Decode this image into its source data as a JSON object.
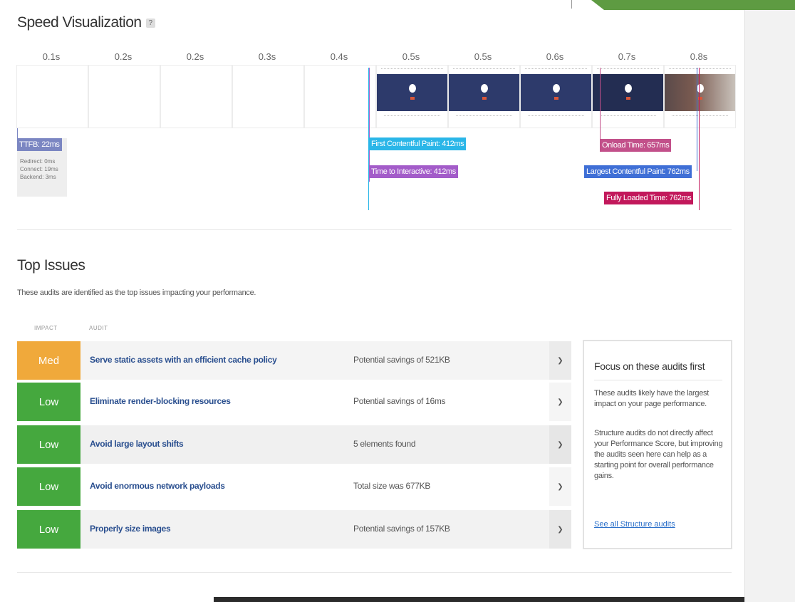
{
  "speed_visualization": {
    "title": "Speed Visualization",
    "help_icon": "help-icon",
    "ticks": [
      "0.1s",
      "0.2s",
      "0.2s",
      "0.3s",
      "0.4s",
      "0.5s",
      "0.5s",
      "0.6s",
      "0.7s",
      "0.8s"
    ],
    "ttfb": {
      "label": "TTFB: 22ms",
      "details": [
        "Redirect: 0ms",
        "Connect: 19ms",
        "Backend: 3ms"
      ]
    },
    "markers": {
      "fcp": "First Contentful Paint: 412ms",
      "tti": "Time to Interactive: 412ms",
      "onload": "Onload Time: 657ms",
      "lcp": "Largest Contentful Paint: 762ms",
      "fully_loaded": "Fully Loaded Time: 762ms"
    },
    "colors": {
      "ttfb": "#7b86c2",
      "fcp": "#2ab6e8",
      "tti": "#a35cc9",
      "onload": "#c2508a",
      "lcp": "#3f6fd6",
      "fully_loaded": "#c2185b"
    }
  },
  "top_issues": {
    "title": "Top Issues",
    "description": "These audits are identified as the top issues impacting your performance.",
    "columns": {
      "impact": "IMPACT",
      "audit": "AUDIT"
    },
    "rows": [
      {
        "impact": "Med",
        "title": "Serve static assets with an efficient cache policy",
        "value": "Potential savings of 521KB"
      },
      {
        "impact": "Low",
        "title": "Eliminate render-blocking resources",
        "value": "Potential savings of 16ms"
      },
      {
        "impact": "Low",
        "title": "Avoid large layout shifts",
        "value": "5 elements found"
      },
      {
        "impact": "Low",
        "title": "Avoid enormous network payloads",
        "value": "Total size was 677KB"
      },
      {
        "impact": "Low",
        "title": "Properly size images",
        "value": "Potential savings of 157KB"
      }
    ],
    "colors": {
      "med": "#f0a93b",
      "low": "#45a83e",
      "link": "#2a4f8f"
    }
  },
  "focus_box": {
    "title": "Focus on these audits first",
    "p1": "These audits likely have the largest impact on your page performance.",
    "p2": "Structure audits do not directly affect your Performance Score, but improving the audits seen here can help as a starting point for overall performance gains.",
    "link": "See all Structure audits"
  }
}
